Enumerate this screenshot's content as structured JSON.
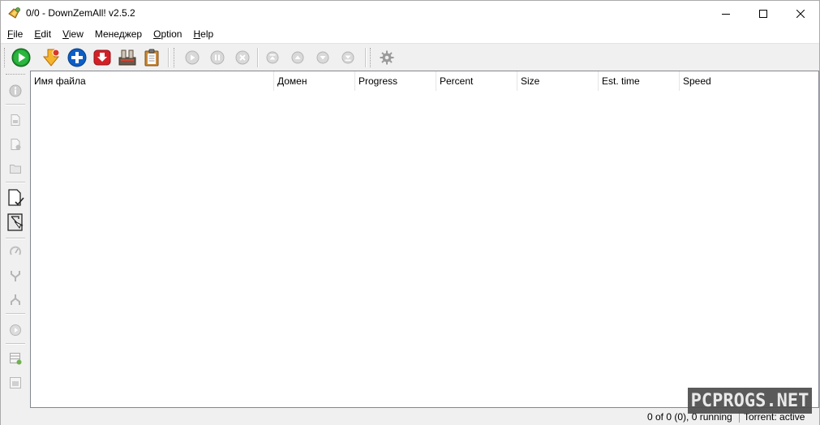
{
  "window": {
    "title": "0/0 - DownZemAll! v2.5.2"
  },
  "menu": [
    {
      "label": "File",
      "underline": "F",
      "rest": "ile"
    },
    {
      "label": "Edit",
      "underline": "E",
      "rest": "dit"
    },
    {
      "label": "View",
      "underline": "V",
      "rest": "iew"
    },
    {
      "label": "Менеджер",
      "underline": "",
      "rest": "Менеджер"
    },
    {
      "label": "Option",
      "underline": "O",
      "rest": "ption"
    },
    {
      "label": "Help",
      "underline": "H",
      "rest": "elp"
    }
  ],
  "toolbar": {
    "buttons": [
      {
        "name": "start-all",
        "icon": "play-green-icon",
        "enabled": true
      },
      {
        "name": "download-content",
        "icon": "download-arrow-icon",
        "enabled": true
      },
      {
        "name": "add-download",
        "icon": "plus-blue-icon",
        "enabled": true
      },
      {
        "name": "stream-download",
        "icon": "download-red-icon",
        "enabled": true
      },
      {
        "name": "batch-download",
        "icon": "batch-icon",
        "enabled": true
      },
      {
        "name": "paste-urls",
        "icon": "clipboard-icon",
        "enabled": true
      },
      {
        "name": "resume",
        "icon": "resume-icon",
        "enabled": false
      },
      {
        "name": "pause",
        "icon": "pause-icon",
        "enabled": false
      },
      {
        "name": "cancel",
        "icon": "cancel-icon",
        "enabled": false
      },
      {
        "name": "move-top",
        "icon": "move-top-icon",
        "enabled": false
      },
      {
        "name": "move-up",
        "icon": "move-up-icon",
        "enabled": false
      },
      {
        "name": "move-down",
        "icon": "move-down-icon",
        "enabled": false
      },
      {
        "name": "move-bottom",
        "icon": "move-bottom-icon",
        "enabled": false
      },
      {
        "name": "settings",
        "icon": "gear-icon",
        "enabled": false
      }
    ]
  },
  "sidebar": {
    "buttons": [
      {
        "name": "info",
        "icon": "info-icon",
        "enabled": false
      },
      {
        "name": "open-file",
        "icon": "file-icon",
        "enabled": false
      },
      {
        "name": "delete-file",
        "icon": "file-delete-icon",
        "enabled": false
      },
      {
        "name": "open-folder",
        "icon": "folder-icon",
        "enabled": false
      },
      {
        "name": "select-completed",
        "icon": "file-check-icon",
        "enabled": true
      },
      {
        "name": "invert-selection",
        "icon": "file-invert-icon",
        "enabled": true
      },
      {
        "name": "speed-limit",
        "icon": "speed-icon",
        "enabled": false
      },
      {
        "name": "merge",
        "icon": "merge-icon",
        "enabled": false
      },
      {
        "name": "split",
        "icon": "split-icon",
        "enabled": false
      },
      {
        "name": "recheck",
        "icon": "recheck-icon",
        "enabled": false
      },
      {
        "name": "add-table",
        "icon": "table-add-icon",
        "enabled": false
      },
      {
        "name": "properties",
        "icon": "properties-icon",
        "enabled": false
      }
    ]
  },
  "table": {
    "columns": [
      "Имя файла",
      "Домен",
      "Progress",
      "Percent",
      "Size",
      "Est. time",
      "Speed"
    ],
    "rows": []
  },
  "status": {
    "summary": "0 of 0 (0), 0 running",
    "torrent": "Torrent: active"
  },
  "watermark": "PCPROGS.NET",
  "colors": {
    "green": "#1a9b2c",
    "blue": "#0c5ec7",
    "red": "#d32027",
    "orange": "#f0a21a",
    "disabled": "#b0b0b0"
  }
}
